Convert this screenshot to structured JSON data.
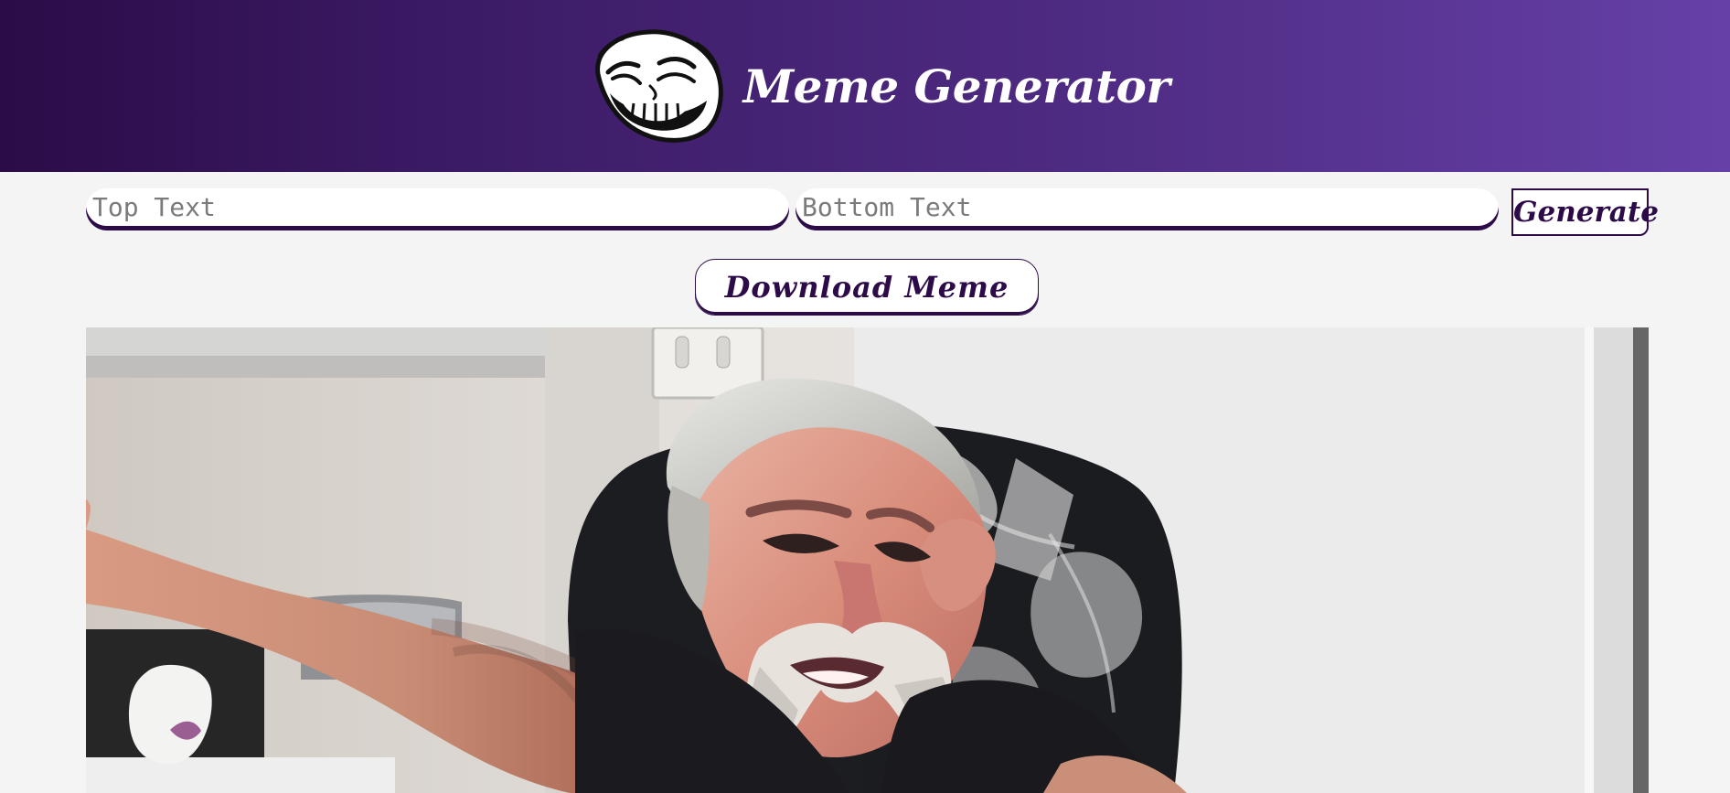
{
  "header": {
    "title": "Meme Generator",
    "logo_icon": "troll-face-icon",
    "gradient_colors": [
      "#2c0b48",
      "#3b1a64",
      "#4d2a80",
      "#6640a7"
    ]
  },
  "inputs": {
    "top_text": {
      "placeholder": "Top Text",
      "value": ""
    },
    "bottom_text": {
      "placeholder": "Bottom Text",
      "value": ""
    }
  },
  "buttons": {
    "generate_label": "Generate",
    "download_label": "Download Meme"
  },
  "meme": {
    "image_icon": "meme-photo-image",
    "accent_color": "#2c0b48"
  }
}
